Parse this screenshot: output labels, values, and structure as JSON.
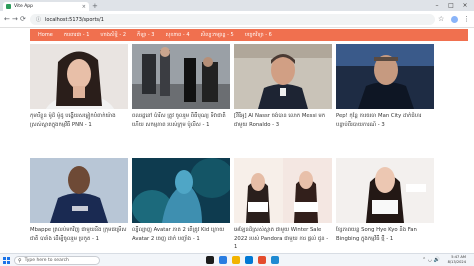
{
  "browser": {
    "tab_title": "Vite App",
    "tab_close": "×",
    "new_tab": "+",
    "url": "localhost:5173/sports/1",
    "win_min": "–",
    "win_max": "□",
    "win_close": "×"
  },
  "nav": {
    "items": [
      {
        "label": "Home"
      },
      {
        "label": "ការពារជា - 1"
      },
      {
        "label": "ហាងសិទ្ធិ - 2"
      },
      {
        "label": "កីឡា - 3"
      },
      {
        "label": "សុខភាព - 4"
      },
      {
        "label": "សិល្បៈកម្សាន្ត - 5"
      },
      {
        "label": "បច្ចេកវិទ្យា - 6"
      }
    ]
  },
  "cards": [
    {
      "caption": "កុមារីខ្លួន ម៉ូដ៏ ម៉ូដូ បង្ហើយសម្លៀកបំពាក់យ៉ាង ស្រស់ស្អាតក្នុងកម្មវិធី PNN - 1",
      "image": "woman-portrait"
    },
    {
      "caption": "ពលរដ្ឋនៅ ប៉ារីស ត្រូវ ចូលរួម ពិធីបុណ្យ ទិវាជាតិ ហើយ សកម្មភាព របស់ក្រុម ប៉ូលីស - 1",
      "image": "street-crowd"
    },
    {
      "caption": "[វីឌីអូ] Al Nassr ចង់បាន លោក Messi មកជាមួយ Ronaldo - 3",
      "image": "man-portrait"
    },
    {
      "caption": "Pep! កុន្តែ ការចរចា Man City ដាក់ជំហរ បន្ទាប់ពីរបាយការណ៍ - 3",
      "image": "coach-portrait"
    },
    {
      "caption": "Mbappe ត្រលប់មកវិញ ជាមួយនឹង ក្រុមជម្រើស ជាតិ បារាំង ដើម្បីចូលរួម ប្រកួត - 1",
      "image": "football-player"
    },
    {
      "caption": "ល្បីល្បាញ Avatar ភាគ 2 តើត្រូវ Kid ក្រោយ Avatar 2 ចេញ ដាក់ បញ្ចាំង - 1",
      "image": "avatar-scene"
    },
    {
      "caption": "អេឡែនដ៏ស្រស់ស្អាត ជាមួយ Winter Sale 2022 របស់ Pandora ជាមួយ ការ ផ្ដល់ ជូន - 1",
      "image": "pandora-promo"
    },
    {
      "caption": "ខ្សែភាពយន្ត Song Hye Kyo និង Fan Bingbing ក្នុងកម្មវិធី ថ្មី - 1",
      "image": "woman-pandora"
    }
  ],
  "taskbar": {
    "search_placeholder": "Type here to search",
    "time": "5:47 AM",
    "date": "8/13/2024"
  }
}
